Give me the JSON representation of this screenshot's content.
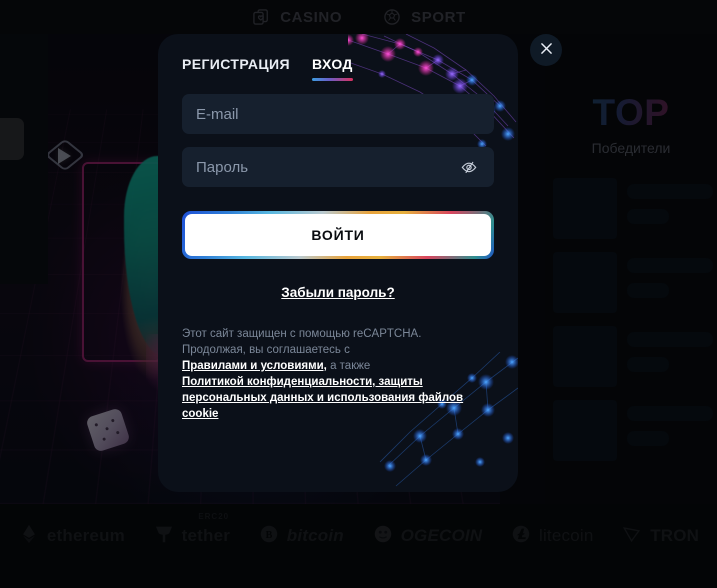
{
  "topnav": {
    "items": [
      {
        "label": "CASINO",
        "icon": "cards-heart-icon"
      },
      {
        "label": "SPORT",
        "icon": "soccer-ball-icon"
      }
    ]
  },
  "right_panel": {
    "title": "TOP",
    "subtitle": "Победители",
    "skeleton_rows": 4
  },
  "modal": {
    "tabs": [
      {
        "label": "РЕГИСТРАЦИЯ",
        "active": false
      },
      {
        "label": "ВХОД",
        "active": true
      }
    ],
    "email": {
      "placeholder": "E-mail",
      "value": ""
    },
    "password": {
      "placeholder": "Пароль",
      "value": "",
      "toggle_icon": "eye-slash-icon"
    },
    "submit_label": "ВОЙТИ",
    "forgot_label": "Забыли пароль?",
    "legal": {
      "line1": "Этот сайт защищен с помощью reCAPTCHA.",
      "line2": "Продолжая, вы соглашаетесь с",
      "terms_link": "Правилами и условиями,",
      "and_text": " а также",
      "privacy_link": "Политикой конфиденциальности, защиты персональных данных и использования файлов cookie"
    }
  },
  "close_button": {
    "icon": "close-x-icon",
    "label": ""
  },
  "crypto_bar": {
    "items": [
      {
        "name": "ethereum",
        "mark": "ethereum-icon"
      },
      {
        "name": "tether",
        "mark": "tether-icon",
        "badge": "ERC20"
      },
      {
        "name": "bitcoin",
        "mark": "bitcoin-icon"
      },
      {
        "name": "OGECOIN",
        "mark": "dogecoin-icon"
      },
      {
        "name": "litecoin",
        "mark": "litecoin-icon"
      },
      {
        "name": "TRON",
        "mark": "tron-icon"
      }
    ]
  },
  "colors": {
    "modal_bg": "#0b1019",
    "field_bg": "#16202e",
    "accent_blue": "#3d9de0",
    "accent_pink": "#d8315f",
    "submit_bg": "#ffffff",
    "page_bg": "#08090c"
  }
}
